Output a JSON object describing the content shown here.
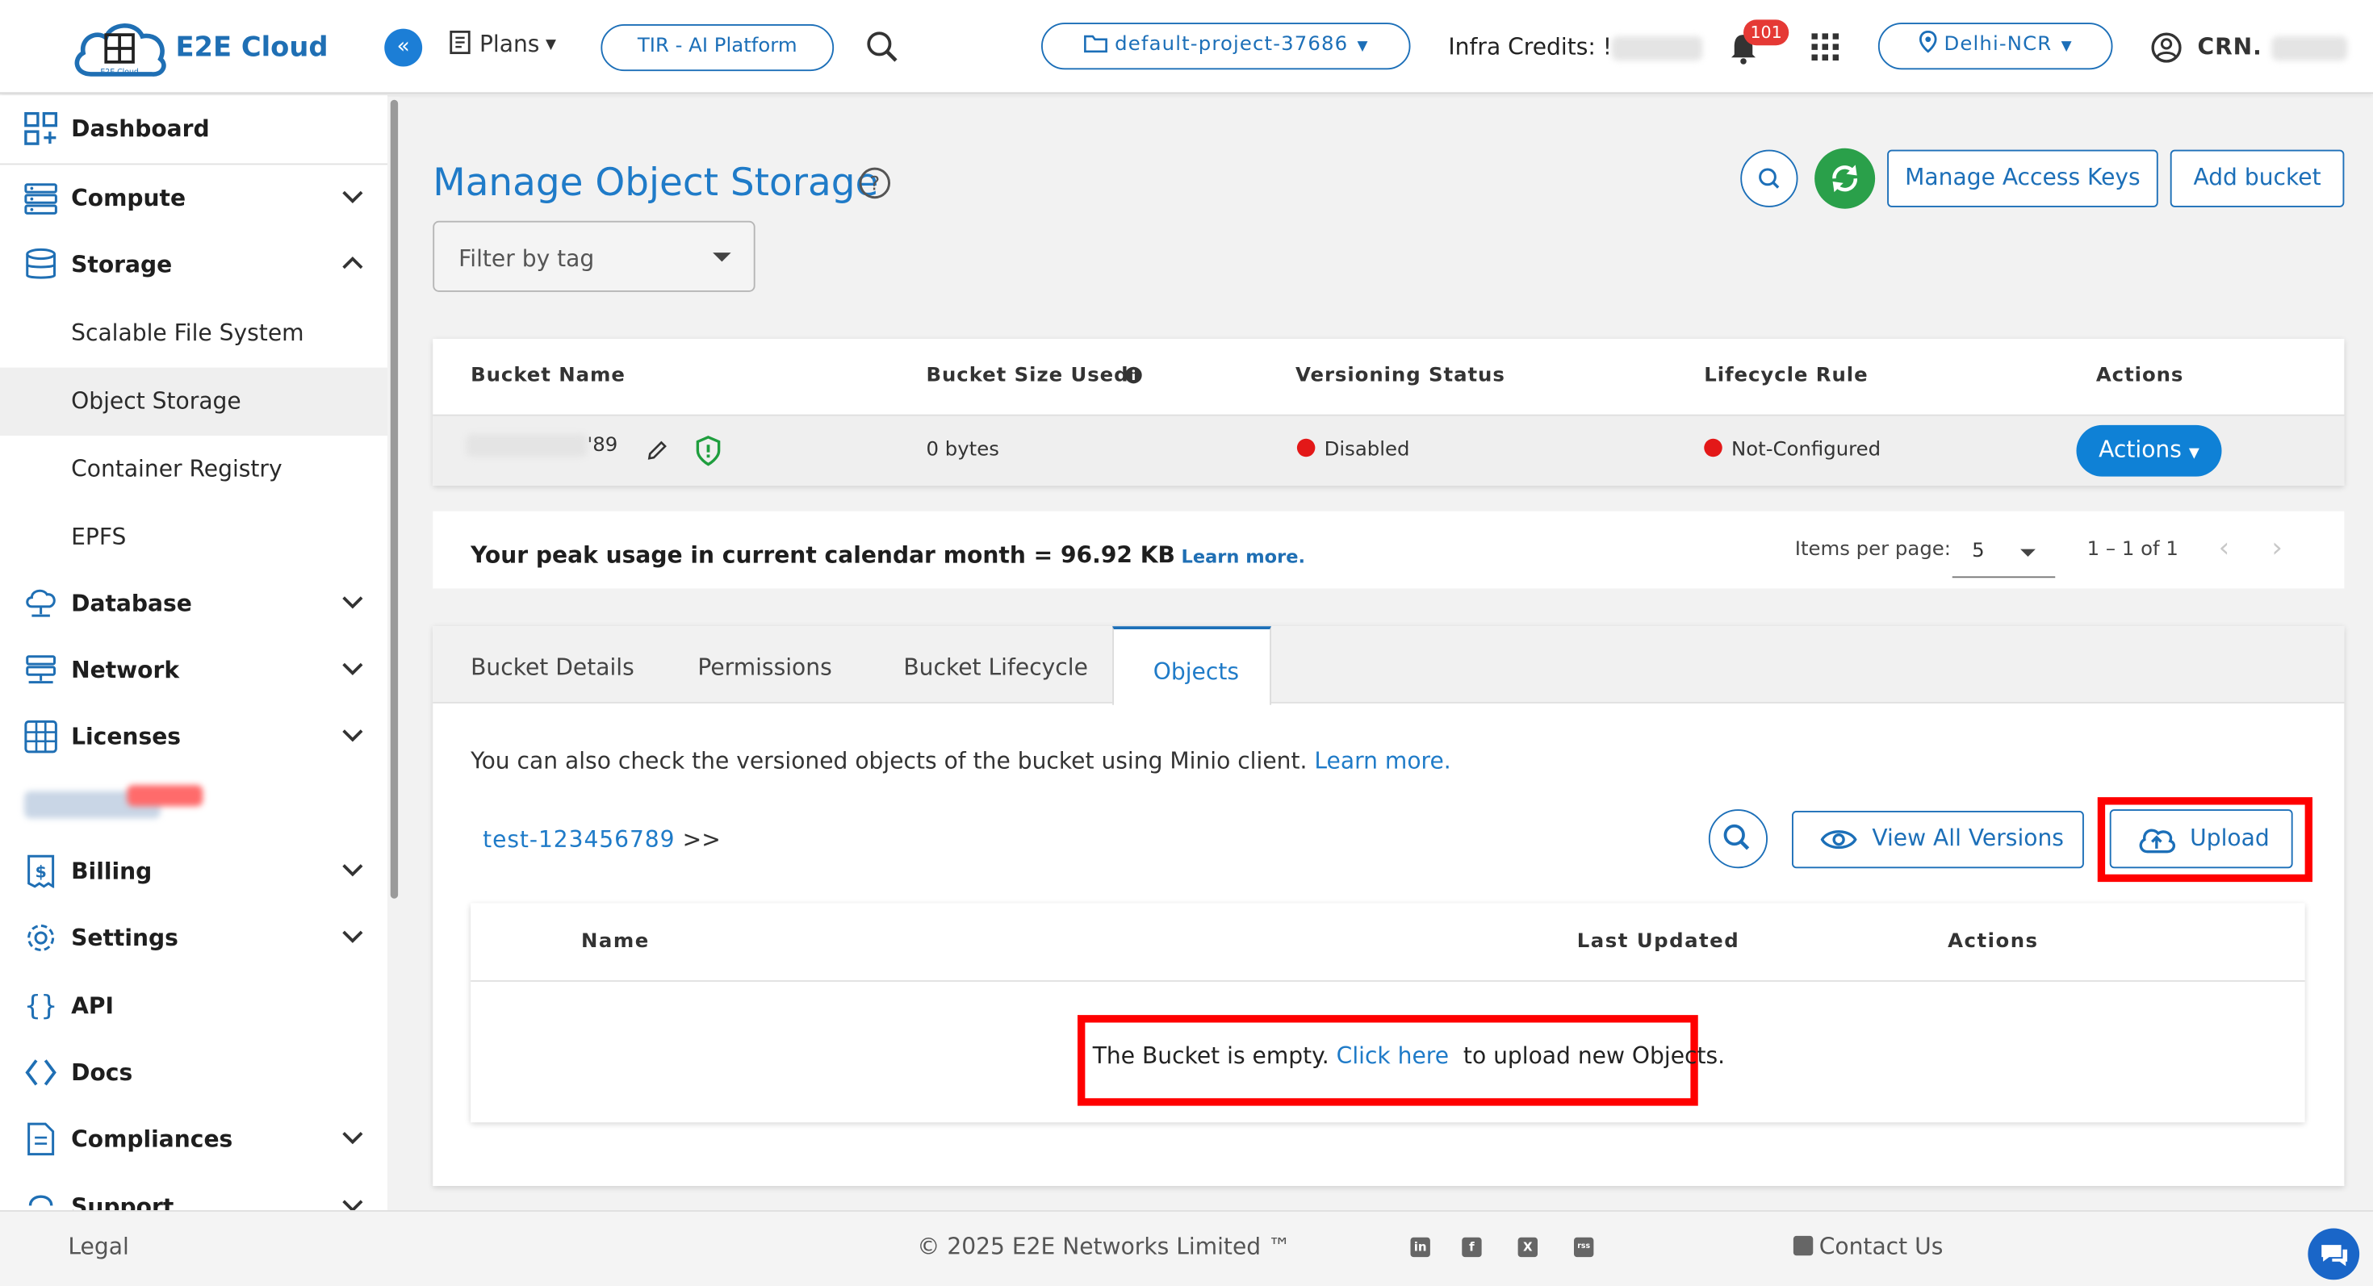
{
  "header": {
    "logo_text": "E2E Cloud",
    "logo_sub": "E2E Cloud",
    "collapse_icon": "«",
    "plans_label": "Plans",
    "platform_button": "TIR - AI Platform",
    "project_label": "default-project-37686",
    "credits_label": "Infra Credits: !",
    "notification_count": "101",
    "region_label": "Delhi-NCR",
    "account_label": "CRN."
  },
  "sidebar": {
    "items": [
      {
        "label": "Dashboard",
        "icon": "dashboard-icon"
      },
      {
        "label": "Compute",
        "icon": "server-icon"
      },
      {
        "label": "Storage",
        "icon": "database-icon"
      },
      {
        "label": "Database",
        "icon": "cloud-db-icon"
      },
      {
        "label": "Network",
        "icon": "network-icon"
      },
      {
        "label": "Licenses",
        "icon": "grid-icon"
      },
      {
        "label": "Billing",
        "icon": "billing-icon"
      },
      {
        "label": "Settings",
        "icon": "gear-icon"
      },
      {
        "label": "API",
        "icon": "braces-icon"
      },
      {
        "label": "Docs",
        "icon": "code-icon"
      },
      {
        "label": "Compliances",
        "icon": "document-icon"
      },
      {
        "label": "Support",
        "icon": "support-icon"
      }
    ],
    "storage_sub": [
      "Scalable File System",
      "Object Storage",
      "Container Registry",
      "EPFS"
    ]
  },
  "main": {
    "title": "Manage Object Storage",
    "manage_keys_label": "Manage Access Keys",
    "add_bucket_label": "Add bucket",
    "filter_placeholder": "Filter by tag",
    "bucket_table": {
      "headers": [
        "Bucket Name",
        "Bucket Size Used",
        "Versioning Status",
        "Lifecycle Rule",
        "Actions"
      ],
      "row": {
        "name_suffix": "'89",
        "size": "0 bytes",
        "versioning": "Disabled",
        "lifecycle": "Not-Configured",
        "actions_label": "Actions"
      }
    },
    "peak_usage": {
      "text": "Your peak usage in current calendar month = 96.92 KB",
      "link": "Learn more.",
      "items_per_page_label": "Items per page:",
      "items_per_page": "5",
      "range": "1 – 1 of 1",
      "prev_icon": "‹",
      "next_icon": "›"
    },
    "tabs": [
      "Bucket Details",
      "Permissions",
      "Bucket Lifecycle",
      "Objects"
    ],
    "objects": {
      "minio_text": "You can also check the versioned objects of the bucket using Minio client.",
      "minio_link": "Learn more.",
      "breadcrumb": "test-123456789",
      "breadcrumb_sep": ">>",
      "view_versions_label": "View All Versions",
      "upload_label": "Upload",
      "table_headers": [
        "Name",
        "Last Updated",
        "Actions"
      ],
      "empty_text_before": "The Bucket is empty.",
      "empty_link": "Click here",
      "empty_text_after": "to upload new Objects."
    }
  },
  "footer": {
    "legal": "Legal",
    "copyright": "© 2025 E2E Networks Limited ™",
    "socials": [
      "in",
      "f",
      "X",
      "rss"
    ],
    "contact": "Contact Us"
  },
  "colors": {
    "accent": "#1c6fb8",
    "title_blue": "#1f7bc8",
    "status_red": "#e31818",
    "highlight_red": "#ff0000",
    "refresh_green": "#2aa04a"
  }
}
